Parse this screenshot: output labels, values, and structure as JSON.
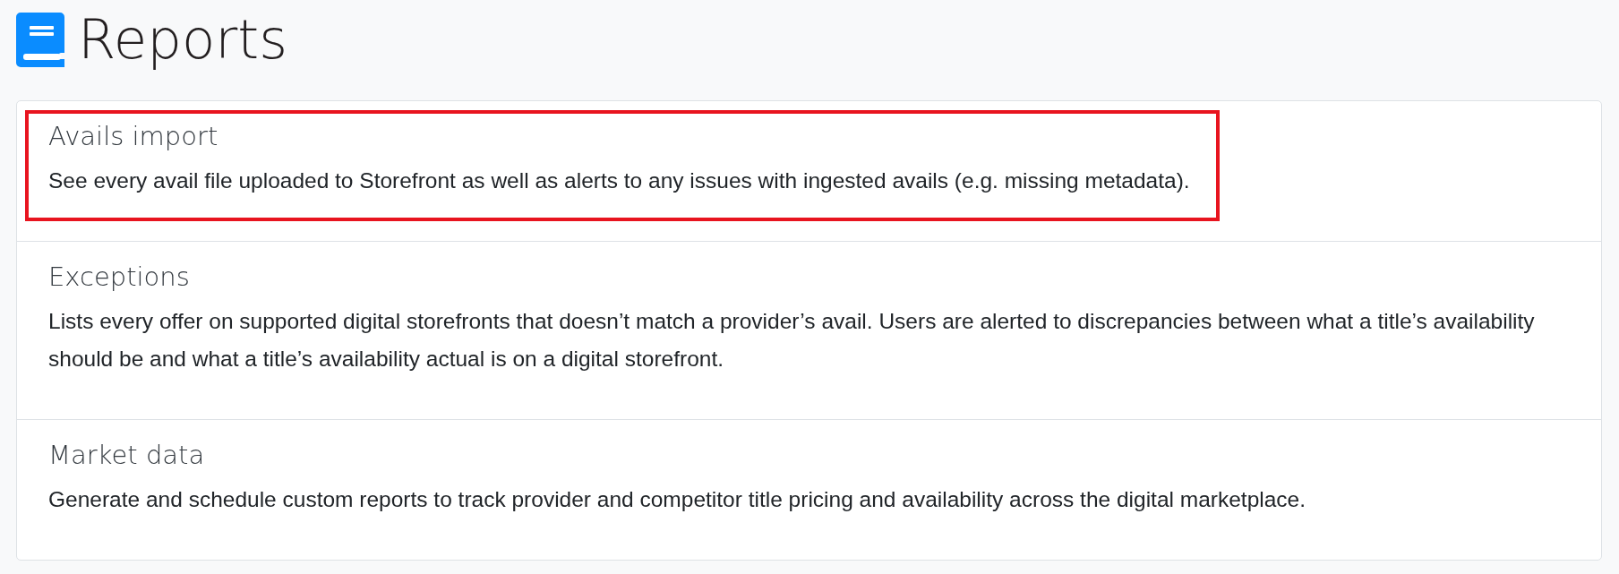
{
  "page": {
    "title": "Reports"
  },
  "reports": [
    {
      "title": "Avails import",
      "description": "See every avail file uploaded to Storefront as well as alerts to any issues with ingested avails (e.g. missing metadata).",
      "highlighted": true
    },
    {
      "title": "Exceptions",
      "description": "Lists every offer on supported digital storefronts that doesn’t match a provider’s avail. Users are alerted to discrepancies between what a title’s availability should be and what a title’s availability actual is on a digital storefront.",
      "highlighted": false
    },
    {
      "title": "Market data",
      "description": "Generate and schedule custom reports to track provider and competitor title pricing and availability across the digital marketplace.",
      "highlighted": false
    }
  ]
}
